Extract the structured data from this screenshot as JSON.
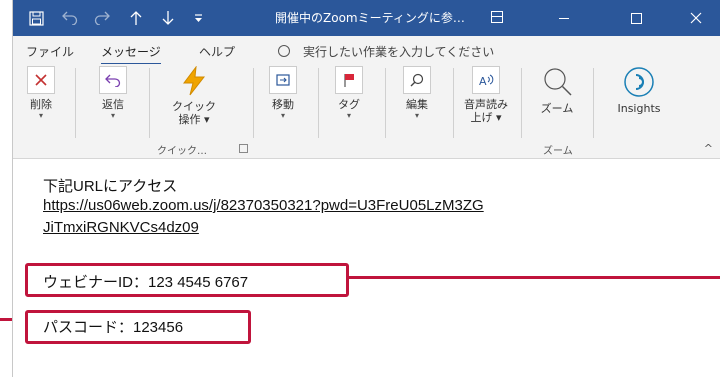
{
  "titlebar": {
    "title": "開催中のZoomミーティングに参…",
    "accent_color": "#2b579a",
    "icons": [
      "save-icon",
      "undo-icon",
      "redo-icon",
      "up-arrow-icon",
      "down-arrow-icon",
      "customize-dropdown-icon",
      "window-layout-icon",
      "minimize-icon",
      "maximize-icon",
      "close-icon"
    ]
  },
  "menu": {
    "file": "ファイル",
    "message": "メッセージ",
    "help": "ヘルプ",
    "tell_me": "実行したい作業を入力してください"
  },
  "ribbon": {
    "delete": "削除",
    "reply": "返信",
    "quick_line1": "クイック",
    "quick_line2": "操作 ▾",
    "move": "移動",
    "tag": "タグ",
    "edit": "編集",
    "read_line1": "音声読み",
    "read_line2": "上げ ▾",
    "zoom": "ズーム",
    "insights": "Insights",
    "group_quick": "クイック…",
    "group_zoom": "ズーム",
    "caret": "▾",
    "collapse": "^"
  },
  "body": {
    "access_text": "下記URLにアクセス",
    "url_line1": "https://us06web.zoom.us/j/82370350321?pwd=U3FreU05LzM3ZG",
    "url_line2": "JiTmxiRGNKVCs4dz09",
    "webinar_id": "ウェビナーID：123 4545 6767",
    "passcode": "パスコード：123456"
  },
  "highlight_color": "#c0143c"
}
